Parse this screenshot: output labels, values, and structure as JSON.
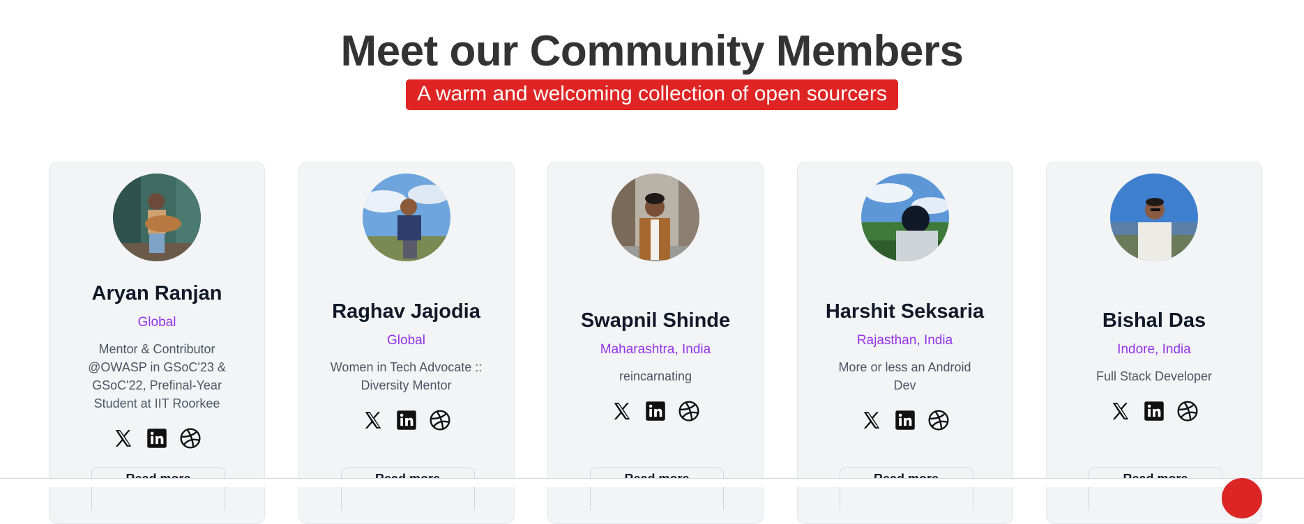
{
  "header": {
    "title": "Meet our Community Members",
    "subtitle": "A warm and welcoming collection of open sourcers"
  },
  "colors": {
    "accent_red": "#e02424",
    "location_purple": "#9333ea",
    "card_bg": "#f3f4f6"
  },
  "members": [
    {
      "name": "Aryan Ranjan",
      "location": "Global",
      "bio": "Mentor & Contributor @OWASP in GSoC'23 & GSoC'22, Prefinal-Year Student at IIT Roorkee",
      "more_label": "Read more",
      "socials": [
        "x-icon",
        "linkedin-icon",
        "dribbble-icon"
      ]
    },
    {
      "name": "Raghav Jajodia",
      "location": "Global",
      "bio": "Women in Tech Advocate :: Diversity Mentor",
      "more_label": "Read more",
      "socials": [
        "x-icon",
        "linkedin-icon",
        "dribbble-icon"
      ]
    },
    {
      "name": "Swapnil Shinde",
      "location": "Maharashtra, India",
      "bio": "reincarnating",
      "more_label": "Read more",
      "socials": [
        "x-icon",
        "linkedin-icon",
        "dribbble-icon"
      ]
    },
    {
      "name": "Harshit Seksaria",
      "location": "Rajasthan, India",
      "bio": "More or less an Android Dev",
      "more_label": "Read more",
      "socials": [
        "x-icon",
        "linkedin-icon",
        "dribbble-icon"
      ]
    },
    {
      "name": "Bishal Das",
      "location": "Indore, India",
      "bio": "Full Stack Developer",
      "more_label": "Read more",
      "socials": [
        "x-icon",
        "linkedin-icon",
        "dribbble-icon"
      ]
    }
  ]
}
